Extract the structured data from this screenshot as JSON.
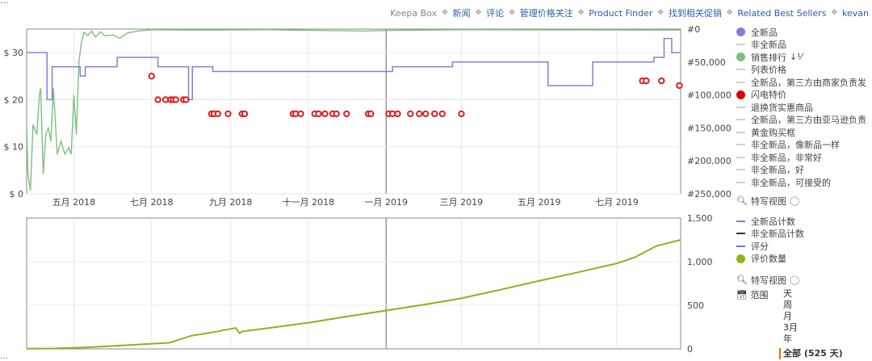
{
  "top": {
    "cut_text": "…",
    "brand": "Keepa Box",
    "links": [
      "新闻",
      "评论",
      "管理价格关注",
      "Product Finder",
      "找到相关促销",
      "Related Best Sellers",
      "kevan"
    ]
  },
  "chart_data": [
    {
      "type": "line",
      "title": "",
      "xlabel": "",
      "ylabel": "",
      "x_ticks": [
        "五月 2018",
        "七月 2018",
        "九月 2018",
        "十一月 2018",
        "一月 2019",
        "三月 2019",
        "五月 2019",
        "七月 2019"
      ],
      "y_left_ticks": [
        "$ 30",
        "$ 20",
        "$ 10",
        "$ 0"
      ],
      "y_left_range": [
        0,
        35
      ],
      "y_right_ticks": [
        "#0",
        "#50,000",
        "#100,000",
        "#150,000",
        "#200,000",
        "#250,000"
      ],
      "y_right_range": [
        0,
        250000
      ],
      "y_right_reversed": true,
      "date_range": [
        "2018-03-25",
        "2019-08-20"
      ],
      "series": [
        {
          "name": "全新品",
          "color": "#8080d8",
          "points": [
            [
              "2018-03-25",
              30
            ],
            [
              "2018-04-08",
              30
            ],
            [
              "2018-04-10",
              20
            ],
            [
              "2018-04-14",
              27
            ],
            [
              "2018-05-04",
              27
            ],
            [
              "2018-05-06",
              25
            ],
            [
              "2018-05-10",
              27
            ],
            [
              "2018-06-02",
              27
            ],
            [
              "2018-06-04",
              29
            ],
            [
              "2018-07-04",
              29
            ],
            [
              "2018-07-06",
              27
            ],
            [
              "2018-07-28",
              27
            ],
            [
              "2018-07-30",
              20
            ],
            [
              "2018-08-02",
              27
            ],
            [
              "2018-08-16",
              27
            ],
            [
              "2018-08-18",
              26
            ],
            [
              "2019-01-03",
              26
            ],
            [
              "2019-01-06",
              27
            ],
            [
              "2019-02-20",
              27
            ],
            [
              "2019-02-22",
              28
            ],
            [
              "2019-05-06",
              28
            ],
            [
              "2019-05-08",
              23
            ],
            [
              "2019-06-10",
              23
            ],
            [
              "2019-06-12",
              28
            ],
            [
              "2019-07-28",
              28
            ],
            [
              "2019-07-30",
              29
            ],
            [
              "2019-08-05",
              29
            ],
            [
              "2019-08-07",
              33
            ],
            [
              "2019-08-11",
              33
            ],
            [
              "2019-08-13",
              30
            ],
            [
              "2019-08-20",
              30
            ]
          ]
        },
        {
          "name": "销售排行",
          "color": "#7fbf7f",
          "axis": "right",
          "points": [
            [
              "2018-03-25",
              145000
            ],
            [
              "2018-03-26",
              220000
            ],
            [
              "2018-03-28",
              245000
            ],
            [
              "2018-03-30",
              145000
            ],
            [
              "2018-04-02",
              160000
            ],
            [
              "2018-04-04",
              100000
            ],
            [
              "2018-04-05",
              90000
            ],
            [
              "2018-04-07",
              220000
            ],
            [
              "2018-04-09",
              160000
            ],
            [
              "2018-04-11",
              150000
            ],
            [
              "2018-04-13",
              170000
            ],
            [
              "2018-04-15",
              90000
            ],
            [
              "2018-04-18",
              190000
            ],
            [
              "2018-04-21",
              170000
            ],
            [
              "2018-04-24",
              190000
            ],
            [
              "2018-04-27",
              180000
            ],
            [
              "2018-04-29",
              190000
            ],
            [
              "2018-05-01",
              100000
            ],
            [
              "2018-05-03",
              160000
            ],
            [
              "2018-05-05",
              50000
            ],
            [
              "2018-05-07",
              20000
            ],
            [
              "2018-05-09",
              5000
            ],
            [
              "2018-05-12",
              10000
            ],
            [
              "2018-05-15",
              3000
            ],
            [
              "2018-05-18",
              12000
            ],
            [
              "2018-05-22",
              4000
            ],
            [
              "2018-05-25",
              10000
            ],
            [
              "2018-06-01",
              9000
            ],
            [
              "2018-06-06",
              14000
            ],
            [
              "2018-06-12",
              6000
            ],
            [
              "2018-06-20",
              3000
            ],
            [
              "2018-07-01",
              1000
            ],
            [
              "2018-08-01",
              1500
            ],
            [
              "2018-10-01",
              1000
            ],
            [
              "2018-12-15",
              3000
            ],
            [
              "2019-01-01",
              2000
            ],
            [
              "2019-03-01",
              1000
            ],
            [
              "2019-08-20",
              1500
            ]
          ]
        },
        {
          "name": "闪电特价",
          "color": "#dd1f1f",
          "type": "scatter",
          "points": [
            [
              "2018-07-01",
              25
            ],
            [
              "2018-07-06",
              20
            ],
            [
              "2018-07-12",
              20
            ],
            [
              "2018-07-16",
              20
            ],
            [
              "2018-07-18",
              20
            ],
            [
              "2018-07-20",
              20
            ],
            [
              "2018-07-26",
              20
            ],
            [
              "2018-07-28",
              20
            ],
            [
              "2018-08-17",
              17
            ],
            [
              "2018-08-19",
              17
            ],
            [
              "2018-08-22",
              17
            ],
            [
              "2018-08-30",
              17
            ],
            [
              "2018-09-10",
              17
            ],
            [
              "2018-09-12",
              17
            ],
            [
              "2018-10-20",
              17
            ],
            [
              "2018-10-22",
              17
            ],
            [
              "2018-10-26",
              17
            ],
            [
              "2018-11-06",
              17
            ],
            [
              "2018-11-09",
              17
            ],
            [
              "2018-11-14",
              17
            ],
            [
              "2018-11-20",
              17
            ],
            [
              "2018-11-23",
              17
            ],
            [
              "2018-12-01",
              17
            ],
            [
              "2018-12-18",
              17
            ],
            [
              "2018-12-20",
              17
            ],
            [
              "2019-01-03",
              17
            ],
            [
              "2019-01-06",
              17
            ],
            [
              "2019-01-10",
              17
            ],
            [
              "2019-01-20",
              17
            ],
            [
              "2019-01-27",
              17
            ],
            [
              "2019-02-01",
              17
            ],
            [
              "2019-02-08",
              17
            ],
            [
              "2019-02-14",
              17
            ],
            [
              "2019-03-01",
              17
            ],
            [
              "2019-07-21",
              24
            ],
            [
              "2019-07-24",
              24
            ],
            [
              "2019-08-05",
              24
            ],
            [
              "2019-08-19",
              23
            ]
          ]
        }
      ]
    },
    {
      "type": "line",
      "title": "",
      "xlabel": "",
      "ylabel": "",
      "y_right_ticks": [
        "1,500",
        "1,000",
        "500",
        "0"
      ],
      "y_range": [
        0,
        1500
      ],
      "series": [
        {
          "name": "评价数量",
          "color": "#8cb21a",
          "points": [
            [
              "2018-03-25",
              2
            ],
            [
              "2018-04-15",
              5
            ],
            [
              "2018-05-15",
              20
            ],
            [
              "2018-06-15",
              45
            ],
            [
              "2018-07-15",
              70
            ],
            [
              "2018-08-01",
              150
            ],
            [
              "2018-08-20",
              195
            ],
            [
              "2018-09-05",
              240
            ],
            [
              "2018-09-08",
              180
            ],
            [
              "2018-09-10",
              200
            ],
            [
              "2018-10-01",
              240
            ],
            [
              "2018-11-01",
              300
            ],
            [
              "2018-12-01",
              370
            ],
            [
              "2019-01-01",
              440
            ],
            [
              "2019-02-01",
              510
            ],
            [
              "2019-03-01",
              580
            ],
            [
              "2019-04-01",
              680
            ],
            [
              "2019-05-01",
              780
            ],
            [
              "2019-06-01",
              880
            ],
            [
              "2019-07-01",
              980
            ],
            [
              "2019-07-15",
              1050
            ],
            [
              "2019-08-01",
              1180
            ],
            [
              "2019-08-20",
              1250
            ]
          ]
        }
      ]
    }
  ],
  "legend_top": [
    {
      "label": "全新品",
      "kind": "dot",
      "color": "#8080d8"
    },
    {
      "label": "非全新品",
      "kind": "line",
      "color": "#d0d0d0"
    },
    {
      "label": "销售排行",
      "kind": "dot",
      "color": "#7fbf7f",
      "suffix": "↓⅟"
    },
    {
      "label": "列表价格",
      "kind": "line",
      "color": "#d0d0d0"
    },
    {
      "label": "全新品，第三方由商家负责发",
      "kind": "line",
      "color": "#d0d0d0"
    },
    {
      "label": "闪电特价",
      "kind": "dot",
      "color": "#e00000"
    },
    {
      "label": "退换货实惠商品",
      "kind": "line",
      "color": "#d0d0d0"
    },
    {
      "label": "全新品，第三方由亚马逊负责",
      "kind": "line",
      "color": "#d0d0d0"
    },
    {
      "label": "黄金购买框",
      "kind": "line",
      "color": "#d0d0d0"
    },
    {
      "label": "非全新品，像新品一样",
      "kind": "line",
      "color": "#d0d0d0"
    },
    {
      "label": "非全新品，非常好",
      "kind": "line",
      "color": "#d0d0d0"
    },
    {
      "label": "非全新品，好",
      "kind": "line",
      "color": "#d0d0d0"
    },
    {
      "label": "非全新品，可接受的",
      "kind": "line",
      "color": "#d0d0d0"
    }
  ],
  "zoom_label": "特写视图",
  "legend_bottom": [
    {
      "label": "全新品计数",
      "kind": "line",
      "color": "#6f8fb8"
    },
    {
      "label": "非全新品计数",
      "kind": "line",
      "color": "#333333"
    },
    {
      "label": "评分",
      "kind": "line",
      "color": "#5a7fbf"
    },
    {
      "label": "评价数量",
      "kind": "dot",
      "color": "#8cb21a"
    }
  ],
  "range": {
    "label": "范围",
    "options": [
      "天",
      "周",
      "月",
      "3月",
      "年"
    ],
    "selected": "全部 (525 天)"
  },
  "bottom_cut": "…"
}
